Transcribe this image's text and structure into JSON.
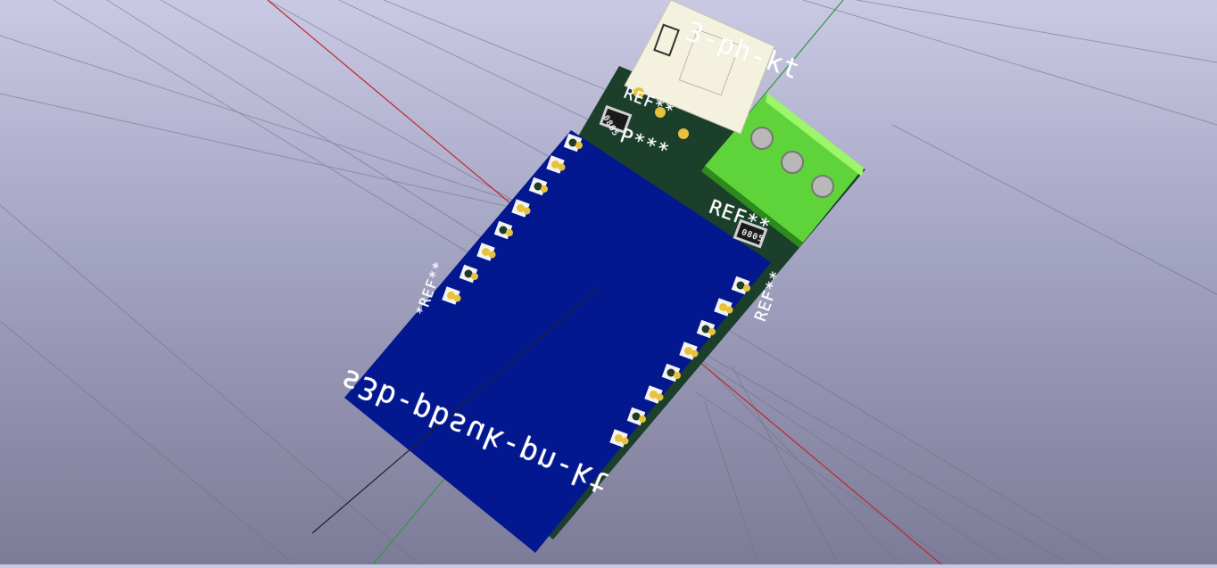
{
  "scene": {
    "background_top": "#c9c9e4",
    "background_bottom": "#7c7c98",
    "axis_x_color": "#c0262c",
    "axis_y_color": "#2c9a3a",
    "axis_z_color": "#20202a"
  },
  "board": {
    "soldermask_color": "#1b3f2a",
    "module_color": "#03188f",
    "terminal_block_color": "#4fcf33",
    "connector_color": "#f4f2de",
    "pad_color": "#e8c23a"
  },
  "silkscreen": {
    "module_name_bottom": "s3b-pbsuk-pn-kt",
    "module_name_top": "3-ph-kt",
    "ref_top": "REF**",
    "ref_mid": "P***",
    "ref_left": "*REF**",
    "ref_right": "REF**",
    "ref_term": "REF**",
    "resistor_label_1": "0805",
    "resistor_label_2": "0805"
  }
}
